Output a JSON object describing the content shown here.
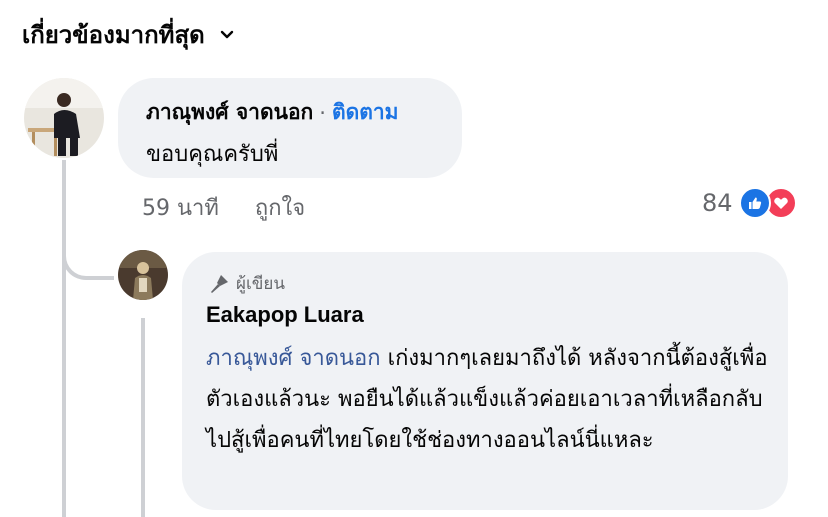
{
  "sort": {
    "label": "เกี่ยวข้องมากที่สุด",
    "icon": "chevron-down-icon"
  },
  "comment1": {
    "author": "ภาณุพงศ์ จาดนอก",
    "separator": "·",
    "follow_label": "ติดตาม",
    "text": "ขอบคุณครับพี่",
    "time": "59 นาที",
    "like_label": "ถูกใจ",
    "reaction_count": "84",
    "reaction_icons": [
      "like-icon",
      "love-icon"
    ]
  },
  "reply": {
    "badge_label": "ผู้เขียน",
    "badge_icon": "microphone-icon",
    "author": "Eakapop Luara",
    "mention": "ภาณุพงศ์ จาดนอก",
    "text": " เก่งมากๆเลยมาถึงได้ หลังจากนี้ต้องสู้เพื่อตัวเองแล้วนะ พอยืนได้แล้วแข็งแล้วค่อยเอาเวลาที่เหลือกลับไปสู้เพื่อคนที่ไทยโดยใช้ช่องทางออนไลน์นี่แหละ"
  },
  "colors": {
    "link": "#1b74e4",
    "mention": "#385898",
    "bubble": "#f0f2f5",
    "like": "#1b74e4",
    "love": "#f33e58"
  }
}
